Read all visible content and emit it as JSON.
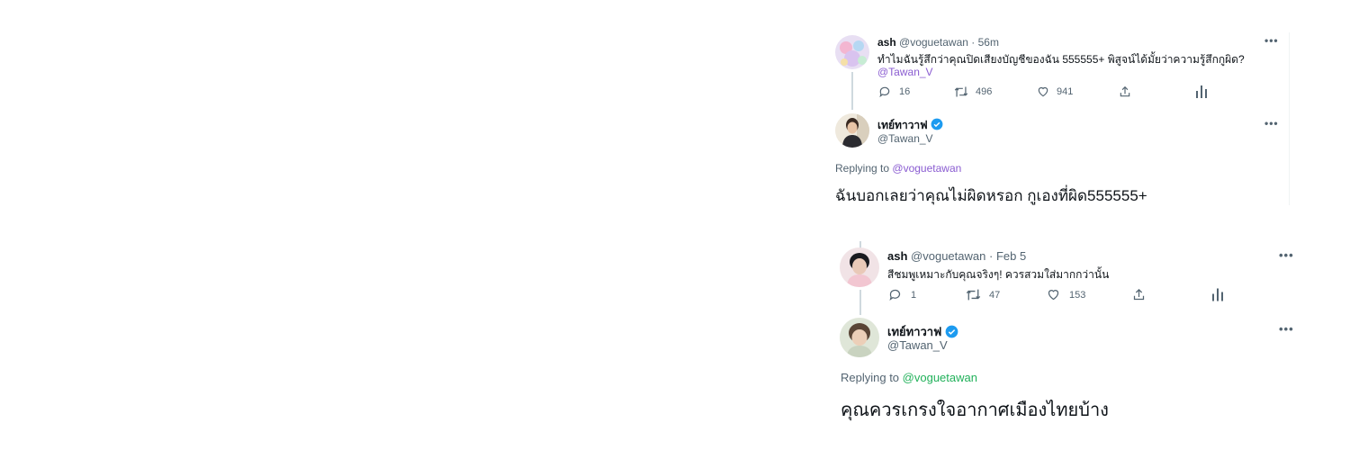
{
  "thread1": {
    "tweet": {
      "display_name": "ash",
      "handle": "@voguetawan",
      "separator": "·",
      "time": "56m",
      "text": "ทำไมฉันรู้สึกว่าคุณปิดเสียงบัญชีของฉัน 555555+ พิสูจน์ได้มั้ยว่าความรู้สึกกูผิด?",
      "mention": "@Tawan_V",
      "replies": "16",
      "retweets": "496",
      "likes": "941"
    },
    "reply": {
      "display_name": "เทย์ทาวาฟ",
      "handle": "@Tawan_V",
      "replying_prefix": "Replying to",
      "replying_handle": "@voguetawan",
      "text": "ฉันบอกเลยว่าคุณไม่ผิดหรอก กูเองที่ผิด555555+"
    }
  },
  "thread2": {
    "tweet": {
      "display_name": "ash",
      "handle": "@voguetawan",
      "separator": "·",
      "time": "Feb 5",
      "text": "สีชมพูเหมาะกับคุณจริงๆ! ควรสวมใส่มากกว่านั้น",
      "replies": "1",
      "retweets": "47",
      "likes": "153"
    },
    "reply": {
      "display_name": "เทย์ทาวาฟ",
      "handle": "@Tawan_V",
      "replying_prefix": "Replying to",
      "replying_handle": "@voguetawan",
      "text": "คุณควรเกรงใจอากาศเมืองไทยบ้าง"
    }
  },
  "icons": {
    "more": "more-horizontal-icon",
    "reply": "reply-icon",
    "retweet": "retweet-icon",
    "like": "heart-icon",
    "share": "share-icon",
    "analytics": "analytics-icon",
    "verified": "verified-badge-icon"
  },
  "colors": {
    "link_purple": "#8a5cd1",
    "link_green": "#21b15a",
    "verified_blue": "#1d9bf0",
    "muted": "#536471"
  }
}
